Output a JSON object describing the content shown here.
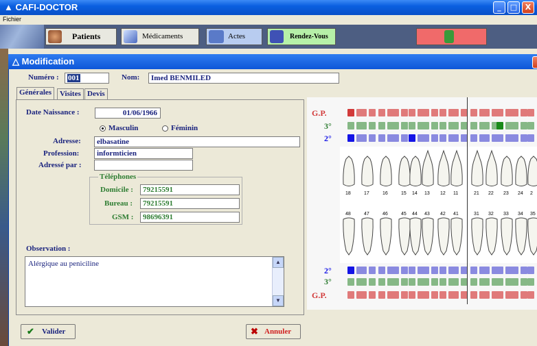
{
  "app": {
    "title": "CAFI-DOCTOR",
    "window_buttons": [
      "_",
      "□",
      "X"
    ]
  },
  "menu": {
    "items": [
      "Fichier"
    ]
  },
  "toolbar": {
    "buttons": [
      {
        "label": "Patients"
      },
      {
        "label": "Médicaments"
      },
      {
        "label": "Actes"
      },
      {
        "label": "Rendez-Vous"
      }
    ],
    "exit_icon": "exit-door-icon"
  },
  "dialog": {
    "title": "Modification",
    "numero_label": "Numéro :",
    "numero_value": "001",
    "nom_label": "Nom:",
    "nom_value": "Imed BENMILED",
    "tabs": [
      {
        "label": "Générales"
      },
      {
        "label": "Visites"
      },
      {
        "label": "Devis"
      }
    ],
    "date_label": "Date Naissance :",
    "date_value": "01/06/1966",
    "sexe": [
      {
        "label": "Masculin",
        "selected": true
      },
      {
        "label": "Féminin",
        "selected": false
      }
    ],
    "adresse_label": "Adresse:",
    "adresse_value": "elbasatine",
    "profession_label": "Profession:",
    "profession_value": "informticien",
    "adresse_par_label": "Adressé par :",
    "adresse_par_value": "",
    "phones": {
      "legend": "Téléphones",
      "domicile_label": "Domicile :",
      "domicile_value": "79215591",
      "bureau_label": "Bureau :",
      "bureau_value": "79215591",
      "gsm_label": "GSM :",
      "gsm_value": "98696391"
    },
    "observation_label": "Observation :",
    "observation_value": "Alérgique au peniciline",
    "valider_label": "Valider",
    "annuler_label": "Annuler"
  },
  "dental_chart": {
    "row_labels_top": [
      "G.P.",
      "3°",
      "2°"
    ],
    "row_labels_bottom": [
      "2°",
      "3°",
      "G.P."
    ],
    "upper_teeth": [
      "18",
      "17",
      "16",
      "15",
      "14",
      "13",
      "12",
      "11",
      "21",
      "22",
      "23",
      "24",
      "2"
    ],
    "lower_teeth": [
      "48",
      "47",
      "46",
      "45",
      "44",
      "43",
      "42",
      "41",
      "31",
      "32",
      "33",
      "34",
      "35"
    ],
    "marked_red_gp_upper": "18",
    "marked_green_3_upper": "23",
    "marked_blue_2_upper": [
      "18",
      "14"
    ],
    "marked_blue_2_lower": [
      "48"
    ]
  },
  "colors": {
    "title_bar": "#0a5fe0",
    "label_navy": "#1a237e",
    "label_green": "#2e7d32",
    "gp_red": "#d23a3a",
    "blue_mark": "#1414e6"
  }
}
